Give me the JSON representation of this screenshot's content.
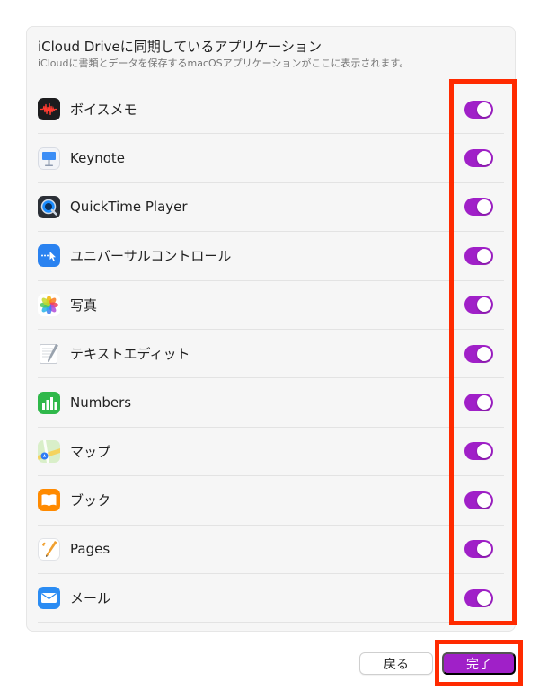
{
  "header": {
    "title": "iCloud Driveに同期しているアプリケーション",
    "subtitle": "iCloudに書類とデータを保存するmacOSアプリケーションがここに表示されます。"
  },
  "apps": [
    {
      "name": "ボイスメモ",
      "icon": "voice-memos-icon",
      "enabled": true
    },
    {
      "name": "Keynote",
      "icon": "keynote-icon",
      "enabled": true
    },
    {
      "name": "QuickTime Player",
      "icon": "quicktime-icon",
      "enabled": true
    },
    {
      "name": "ユニバーサルコントロール",
      "icon": "universal-control-icon",
      "enabled": true
    },
    {
      "name": "写真",
      "icon": "photos-icon",
      "enabled": true
    },
    {
      "name": "テキストエディット",
      "icon": "textedit-icon",
      "enabled": true
    },
    {
      "name": "Numbers",
      "icon": "numbers-icon",
      "enabled": true
    },
    {
      "name": "マップ",
      "icon": "maps-icon",
      "enabled": true
    },
    {
      "name": "ブック",
      "icon": "books-icon",
      "enabled": true
    },
    {
      "name": "Pages",
      "icon": "pages-icon",
      "enabled": true
    },
    {
      "name": "メール",
      "icon": "mail-icon",
      "enabled": true
    }
  ],
  "buttons": {
    "back_label": "戻る",
    "done_label": "完了"
  },
  "colors": {
    "accent": "#a020c8",
    "highlight": "#ff2a00"
  }
}
